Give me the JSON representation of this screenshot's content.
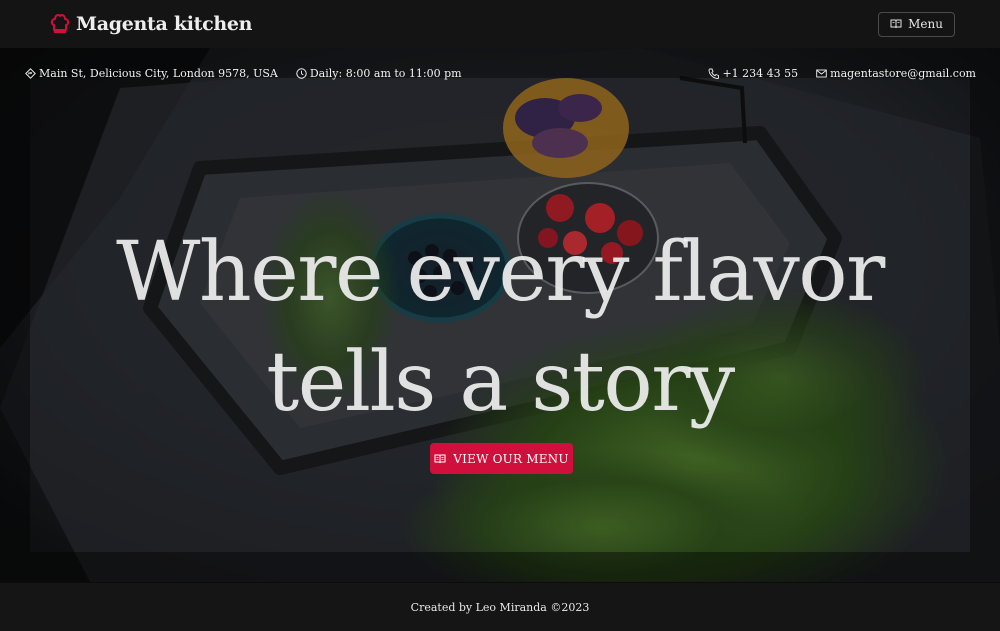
{
  "navbar": {
    "brand_name": "Magenta kitchen",
    "brand_icon": "chef-hat-icon",
    "menu_label": "Menu",
    "menu_icon": "book-icon"
  },
  "info_bar": {
    "address": "Main St, Delicious City, London 9578, USA",
    "hours": "Daily: 8:00 am to 11:00 pm",
    "phone": "+1 234 43 55",
    "email": "magentastore@gmail.com"
  },
  "hero": {
    "headline_line1": "Where every flavor",
    "headline_line2": "tells a story",
    "cta_label": "VIEW OUR MENU",
    "cta_icon": "book-icon"
  },
  "footer": {
    "credit": "Created by Leo Miranda ©2023"
  },
  "colors": {
    "accent": "#d10f3d",
    "navbar_bg": "#141414",
    "footer_bg": "#151515",
    "text": "#f1f1f1"
  }
}
